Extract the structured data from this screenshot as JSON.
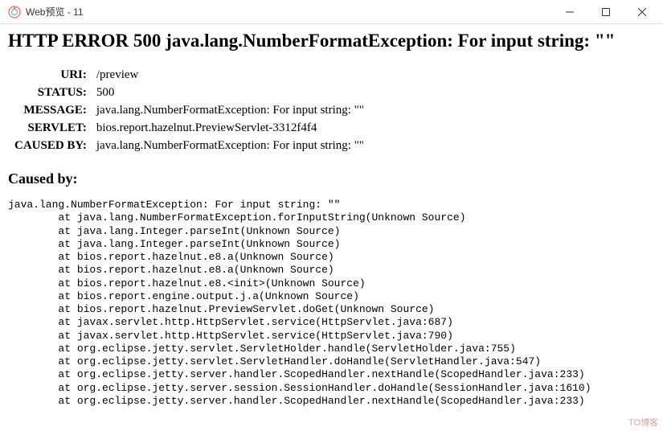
{
  "window": {
    "title": "Web预览 - 11"
  },
  "page": {
    "headline": "HTTP ERROR 500 java.lang.NumberFormatException: For input string: \"\"",
    "fields": {
      "uri_label": "URI:",
      "uri_value": "/preview",
      "status_label": "STATUS:",
      "status_value": "500",
      "message_label": "MESSAGE:",
      "message_value": "java.lang.NumberFormatException: For input string: \"\"",
      "servlet_label": "SERVLET:",
      "servlet_value": "bios.report.hazelnut.PreviewServlet-3312f4f4",
      "causedby_label": "CAUSED BY:",
      "causedby_value": "java.lang.NumberFormatException: For input string: \"\""
    },
    "caused_by_heading": "Caused by:",
    "stacktrace": "java.lang.NumberFormatException: For input string: \"\"\n        at java.lang.NumberFormatException.forInputString(Unknown Source)\n        at java.lang.Integer.parseInt(Unknown Source)\n        at java.lang.Integer.parseInt(Unknown Source)\n        at bios.report.hazelnut.e8.a(Unknown Source)\n        at bios.report.hazelnut.e8.a(Unknown Source)\n        at bios.report.hazelnut.e8.<init>(Unknown Source)\n        at bios.report.engine.output.j.a(Unknown Source)\n        at bios.report.hazelnut.PreviewServlet.doGet(Unknown Source)\n        at javax.servlet.http.HttpServlet.service(HttpServlet.java:687)\n        at javax.servlet.http.HttpServlet.service(HttpServlet.java:790)\n        at org.eclipse.jetty.servlet.ServletHolder.handle(ServletHolder.java:755)\n        at org.eclipse.jetty.servlet.ServletHandler.doHandle(ServletHandler.java:547)\n        at org.eclipse.jetty.server.handler.ScopedHandler.nextHandle(ScopedHandler.java:233)\n        at org.eclipse.jetty.server.session.SessionHandler.doHandle(SessionHandler.java:1610)\n        at org.eclipse.jetty.server.handler.ScopedHandler.nextHandle(ScopedHandler.java:233)"
  },
  "watermark": "TO博客"
}
